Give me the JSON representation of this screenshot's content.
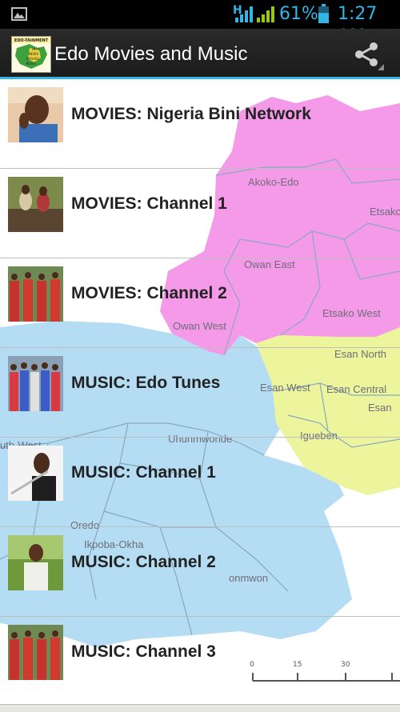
{
  "status_bar": {
    "network_type": "H",
    "battery_percent": "61%",
    "battery_level": 0.61,
    "time": "1:27 AM",
    "accent_color": "#33b5e5",
    "icons": [
      "gallery-icon",
      "signal-icon",
      "signal-icon",
      "battery-icon"
    ]
  },
  "action_bar": {
    "title": "Edo Movies and Music",
    "logo_text": [
      "EDO-TAINMENT",
      "INFO",
      "NEWS",
      "MOVIES",
      "MUSIC"
    ],
    "share_icon": "share-icon",
    "accent_color": "#33b5e5"
  },
  "map": {
    "labels": [
      "Akoko-Edo",
      "Etsako",
      "Owan East",
      "Etsako West",
      "Owan West",
      "Esan North",
      "Esan West",
      "Esan Central",
      "Esan",
      "Uhunmwonde",
      "Igueben",
      "uth-West",
      "Oredo",
      "Ikpoba-Okha",
      "onmwon"
    ],
    "scale_labels": [
      "0",
      "15",
      "30"
    ],
    "colors": {
      "north": "#f59ae9",
      "central": "#ecf59c",
      "south": "#b4dcf2",
      "water": "#ffffff",
      "border": "#8aa7c0"
    }
  },
  "channels": [
    {
      "label": "MOVIES: Nigeria Bini Network",
      "thumb": "person-photo"
    },
    {
      "label": "MOVIES: Channel 1",
      "thumb": "scene-photo"
    },
    {
      "label": "MOVIES: Channel 2",
      "thumb": "group-photo"
    },
    {
      "label": "MUSIC: Edo Tunes",
      "thumb": "group-photo"
    },
    {
      "label": "MUSIC: Channel 1",
      "thumb": "flute-player-photo"
    },
    {
      "label": "MUSIC: Channel 2",
      "thumb": "singer-photo"
    },
    {
      "label": "MUSIC: Channel 3",
      "thumb": "group-photo"
    }
  ]
}
